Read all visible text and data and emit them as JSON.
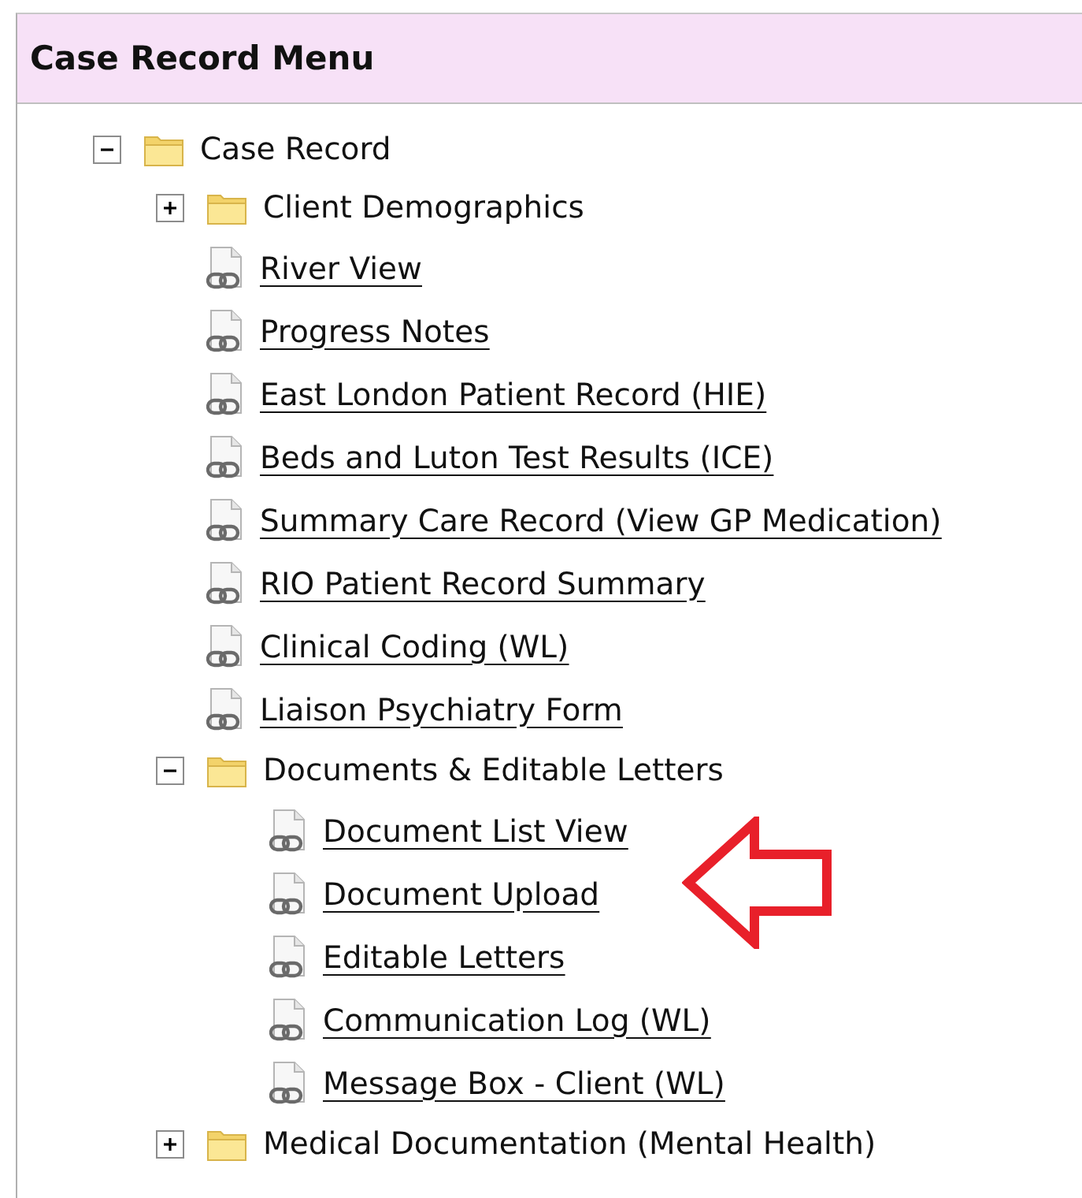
{
  "panel": {
    "title": "Case Record Menu"
  },
  "tree": [
    {
      "kind": "folder",
      "label": "Case Record",
      "expanded": true,
      "children": [
        {
          "kind": "folder",
          "label": "Client Demographics",
          "expanded": false
        },
        {
          "kind": "link",
          "label": "River View"
        },
        {
          "kind": "link",
          "label": "Progress Notes"
        },
        {
          "kind": "link",
          "label": "East London Patient Record (HIE)"
        },
        {
          "kind": "link",
          "label": "Beds and Luton Test Results (ICE)"
        },
        {
          "kind": "link",
          "label": "Summary Care Record (View GP Medication)"
        },
        {
          "kind": "link",
          "label": "RIO Patient Record Summary"
        },
        {
          "kind": "link",
          "label": "Clinical Coding (WL)"
        },
        {
          "kind": "link",
          "label": "Liaison Psychiatry Form"
        },
        {
          "kind": "folder",
          "label": "Documents & Editable Letters",
          "expanded": true,
          "children": [
            {
              "kind": "link",
              "label": "Document List View"
            },
            {
              "kind": "link",
              "label": "Document Upload"
            },
            {
              "kind": "link",
              "label": "Editable Letters"
            },
            {
              "kind": "link",
              "label": "Communication Log (WL)"
            },
            {
              "kind": "link",
              "label": "Message Box - Client (WL)"
            }
          ]
        },
        {
          "kind": "folder",
          "label": "Medical Documentation (Mental Health)",
          "expanded": false
        }
      ]
    }
  ]
}
